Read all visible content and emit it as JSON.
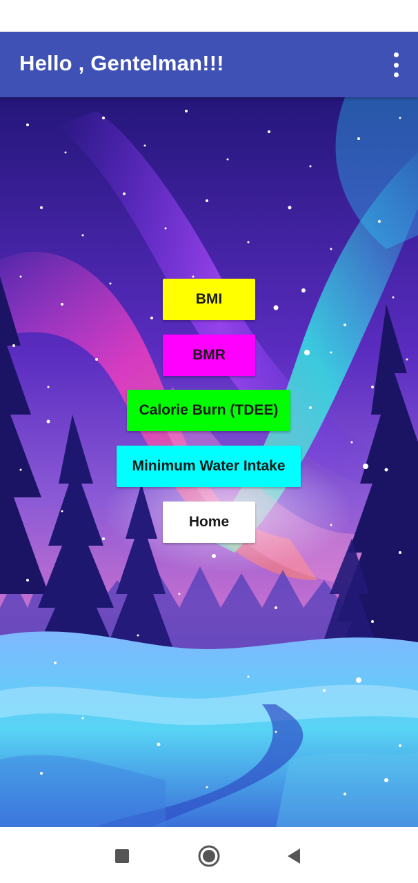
{
  "app_bar": {
    "title": "Hello , Gentelman!!!",
    "background_color": "#3f51b5",
    "overflow_icon": "more-vert-icon"
  },
  "menu": {
    "buttons": [
      {
        "label": "BMI",
        "color": "#ffff00"
      },
      {
        "label": "BMR",
        "color": "#ff00ff"
      },
      {
        "label": "Calorie Burn (TDEE)",
        "color": "#00ff00"
      },
      {
        "label": "Minimum Water Intake",
        "color": "#00ffff"
      },
      {
        "label": "Home",
        "color": "#ffffff"
      }
    ]
  },
  "background": {
    "description_icon": "aurora-winter-forest-image"
  },
  "navigation_bar": {
    "recents_icon": "square-recents-icon",
    "home_icon": "circle-home-icon",
    "back_icon": "triangle-back-icon"
  }
}
